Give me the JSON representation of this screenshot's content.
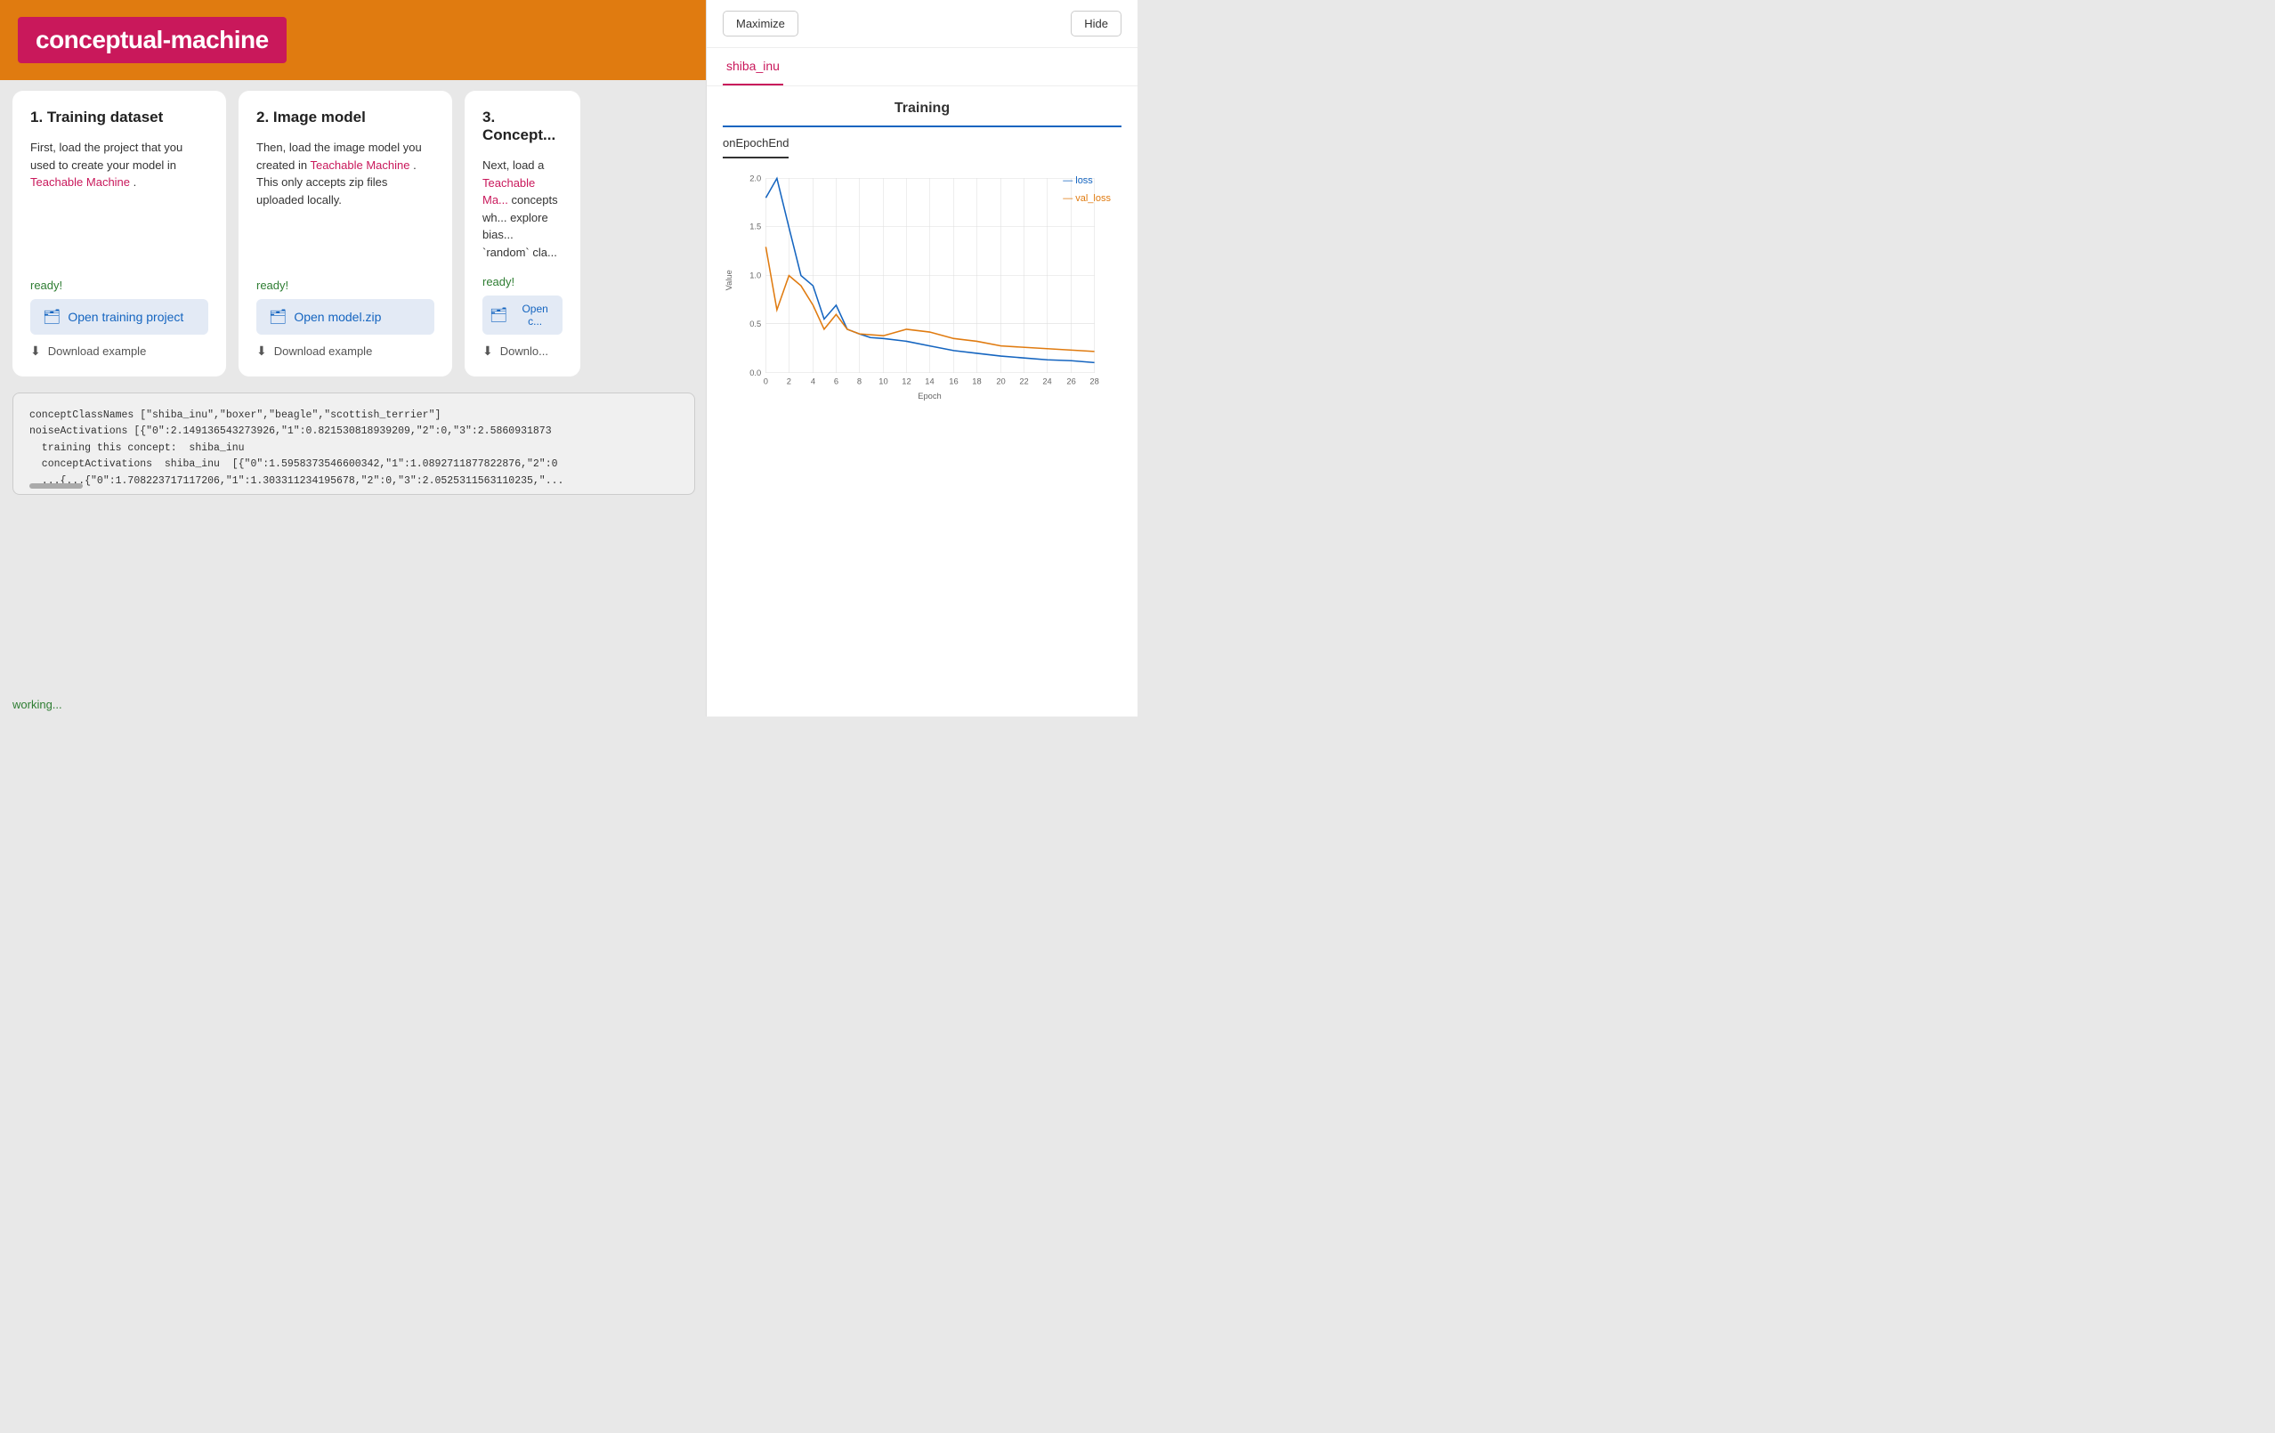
{
  "header": {
    "title": "conceptual-machine"
  },
  "buttons": {
    "maximize": "Maximize",
    "hide": "Hide"
  },
  "tab": {
    "label": "shiba_inu"
  },
  "training": {
    "section_title": "Training",
    "epoch_tab": "onEpochEnd"
  },
  "cards": [
    {
      "title": "1. Training dataset",
      "desc_part1": "First, load the project that you used to create your model in ",
      "link": "Teachable Machine",
      "desc_part2": ".",
      "ready": "ready!",
      "open_btn": "Open training project",
      "download_btn": "Download example"
    },
    {
      "title": "2. Image model",
      "desc_part1": "Then, load the image model you created in ",
      "link": "Teachable Machine",
      "desc_part2": ". This only accepts zip files uploaded locally.",
      "ready": "ready!",
      "open_btn": "Open model.zip",
      "download_btn": "Download example"
    },
    {
      "title": "3. Concept...",
      "desc_part1": "Next, load a ",
      "link": "Teachable Ma...",
      "desc_part2": " concepts wh... explore bias... `random` cla...",
      "ready": "ready!",
      "open_btn": "Open c...",
      "download_btn": "Downlo..."
    }
  ],
  "code": {
    "lines": [
      "conceptClassNames  [\"shiba_inu\",\"boxer\",\"beagle\",\"scottish_terrier\"]",
      "noiseActivations  [{\"0\":2.149136543273926,\"1\":0.821530818939209,\"2\":0,\"3\":2.5860931873",
      "  training this concept:  shiba_inu",
      "  conceptActivations  shiba_inu  [{\"0\":1.5958373546600342,\"1\":1.0892711877822876,\"2\":0",
      "  ...{...{\"0\":1.708223717117206,\"1\":1.303311234195678,\"2\":0,\"3\":2.0525311563110235,\"..."
    ]
  },
  "status": {
    "working": "working..."
  },
  "chart": {
    "y_label": "Value",
    "x_label": "Epoch",
    "legend": {
      "loss": "loss",
      "val_loss": "val_loss"
    },
    "x_ticks": [
      "0",
      "2",
      "4",
      "6",
      "8",
      "10",
      "12",
      "14",
      "16",
      "18",
      "20",
      "22",
      "24",
      "26",
      "28"
    ],
    "y_ticks": [
      "0.0",
      "0.5",
      "1.0",
      "1.5",
      "2.0"
    ],
    "colors": {
      "loss": "#1565c0",
      "val_loss": "#e07b10"
    }
  }
}
